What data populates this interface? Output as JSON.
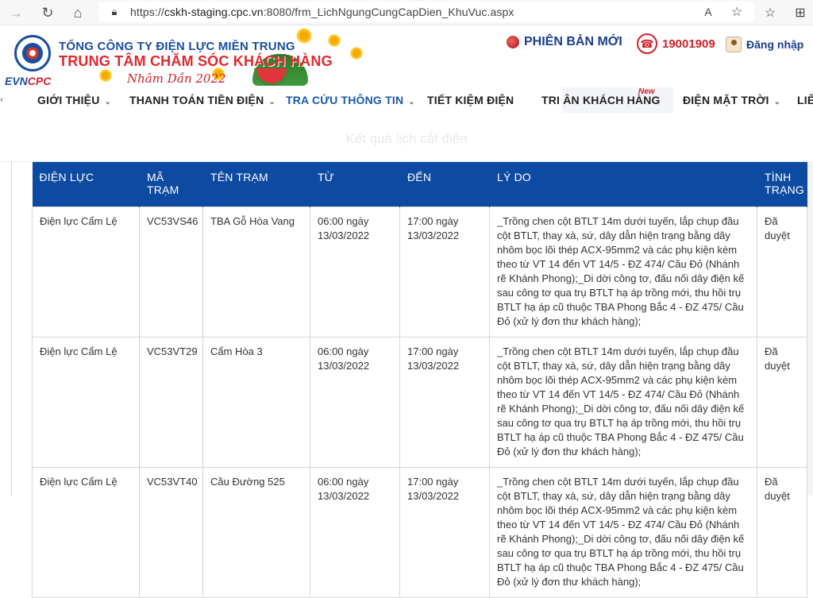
{
  "browser": {
    "url_prefix": "https://",
    "url_host": "cskh-staging.cpc.vn",
    "url_rest": ":8080/frm_LichNgungCungCapDien_KhuVuc.aspx"
  },
  "header": {
    "logo_evn": "EVN",
    "logo_cpc": "CPC",
    "corp_name": "TỔNG CÔNG TY ĐIỆN LỰC MIỀN TRUNG",
    "center_name": "TRUNG TÂM CHĂM SÓC KHÁCH HÀNG",
    "tet_text": "Nhâm Dần 2022",
    "new_version": "PHIÊN BẢN MỚI",
    "hotline": "19001909",
    "login": "Đăng nhập"
  },
  "nav": {
    "items": [
      {
        "label": "GIỚI THIỆU"
      },
      {
        "label": "THANH TOÁN TIỀN ĐIỆN"
      },
      {
        "label": "TRA CỨU THÔNG TIN"
      },
      {
        "label": "TIẾT KIỆM ĐIỆN"
      },
      {
        "label": "TRI ÂN KHÁCH HÀNG"
      },
      {
        "label": "ĐIỆN MẶT TRỜI"
      },
      {
        "label": "LIÊ"
      }
    ],
    "new_badge": "New"
  },
  "page": {
    "title": "Kết quả lịch cắt điện"
  },
  "table": {
    "headers": [
      "ĐIỆN LỰC",
      "MÃ TRẠM",
      "TÊN TRẠM",
      "TỪ",
      "ĐẾN",
      "LÝ DO",
      "TÌNH TRẠNG"
    ],
    "rows": [
      {
        "dien_luc": "Điện lực Cẩm Lệ",
        "ma_tram": "VC53VS46",
        "ten_tram": "TBA Gỗ Hòa Vang",
        "tu": "06:00 ngày 13/03/2022",
        "den": "17:00 ngày 13/03/2022",
        "ly_do": "_Trồng chen cột BTLT 14m dưới tuyến, lắp chụp đầu cột BTLT, thay xà, sứ, dây dẫn hiện trạng bằng dây nhôm bọc lõi thép ACX-95mm2 và các phụ kiện kèm theo từ VT 14 đến VT 14/5 - ĐZ 474/ Cầu Đỏ (Nhánh rẽ Khánh Phong);_Di dời công tơ, đấu nối dây điện kế sau công tơ qua trụ BTLT hạ áp trồng mới, thu hồi trụ BTLT hạ áp cũ thuộc TBA Phong Bắc 4 - ĐZ 475/ Cầu Đỏ (xử lý đơn thư khách hàng);",
        "tinh_trang": "Đã duyệt"
      },
      {
        "dien_luc": "Điện lực Cẩm Lệ",
        "ma_tram": "VC53VT29",
        "ten_tram": "Cẩm Hòa 3",
        "tu": "06:00 ngày 13/03/2022",
        "den": "17:00 ngày 13/03/2022",
        "ly_do": "_Trồng chen cột BTLT 14m dưới tuyến, lắp chụp đầu cột BTLT, thay xà, sứ, dây dẫn hiện trạng bằng dây nhôm bọc lõi thép ACX-95mm2 và các phụ kiện kèm theo từ VT 14 đến VT 14/5 - ĐZ 474/ Cầu Đỏ (Nhánh rẽ Khánh Phong);_Di dời công tơ, đấu nối dây điện kế sau công tơ qua trụ BTLT hạ áp trồng mới, thu hồi trụ BTLT hạ áp cũ thuộc TBA Phong Bắc 4 - ĐZ 475/ Cầu Đỏ (xử lý đơn thư khách hàng);",
        "tinh_trang": "Đã duyệt"
      },
      {
        "dien_luc": "Điện lực Cẩm Lệ",
        "ma_tram": "VC53VT40",
        "ten_tram": "Cầu Đường 525",
        "tu": "06:00 ngày 13/03/2022",
        "den": "17:00 ngày 13/03/2022",
        "ly_do": "_Trồng chen cột BTLT 14m dưới tuyến, lắp chụp đầu cột BTLT, thay xà, sứ, dây dẫn hiện trạng bằng dây nhôm bọc lõi thép ACX-95mm2 và các phụ kiện kèm theo từ VT 14 đến VT 14/5 - ĐZ 474/ Cầu Đỏ (Nhánh rẽ Khánh Phong);_Di dời công tơ, đấu nối dây điện kế sau công tơ qua trụ BTLT hạ áp trồng mới, thu hồi trụ BTLT hạ áp cũ thuộc TBA Phong Bắc 4 - ĐZ 475/ Cầu Đỏ (xử lý đơn thư khách hàng);",
        "tinh_trang": "Đã duyệt"
      }
    ]
  }
}
